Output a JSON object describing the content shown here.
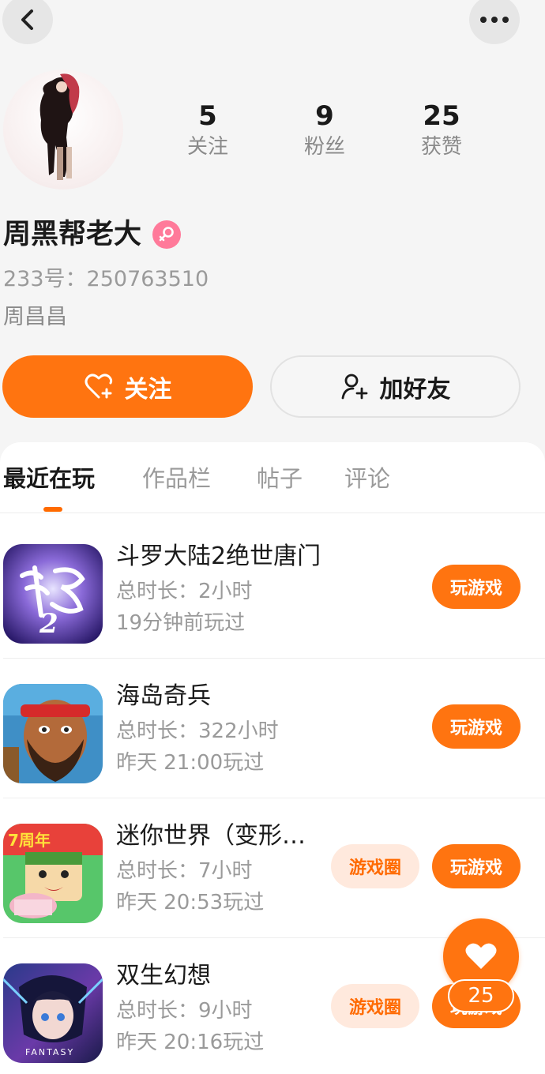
{
  "top_bar": {
    "back_icon": "chevron-left-icon",
    "more_icon": "more-dots-icon"
  },
  "profile": {
    "stats": [
      {
        "value": "5",
        "label": "关注"
      },
      {
        "value": "9",
        "label": "粉丝"
      },
      {
        "value": "25",
        "label": "获赞"
      }
    ],
    "name": "周黑帮老大",
    "gender_icon": "female-icon",
    "uid": "233号：250763510",
    "bio": "周昌昌",
    "follow_label": "关注",
    "add_friend_label": "加好友"
  },
  "tabs": [
    "最近在玩",
    "作品栏",
    "帖子",
    "评论"
  ],
  "games": [
    {
      "title": "斗罗大陆2绝世唐门",
      "duration": "总时长：2小时",
      "last_played": "19分钟前玩过",
      "circle_label": "",
      "play_label": "玩游戏"
    },
    {
      "title": "海岛奇兵",
      "duration": "总时长：322小时",
      "last_played": "昨天 21:00玩过",
      "circle_label": "",
      "play_label": "玩游戏"
    },
    {
      "title": "迷你世界（变形…",
      "duration": "总时长：7小时",
      "last_played": "昨天 20:53玩过",
      "circle_label": "游戏圈",
      "play_label": "玩游戏"
    },
    {
      "title": "双生幻想",
      "duration": "总时长：9小时",
      "last_played": "昨天 20:16玩过",
      "circle_label": "游戏圈",
      "play_label": "玩游戏"
    }
  ],
  "like_fab": {
    "count": "25",
    "icon": "heart-icon"
  },
  "colors": {
    "accent": "#ff7410",
    "accent_light": "#ffe9dd",
    "gender": "#ff7a9a"
  }
}
